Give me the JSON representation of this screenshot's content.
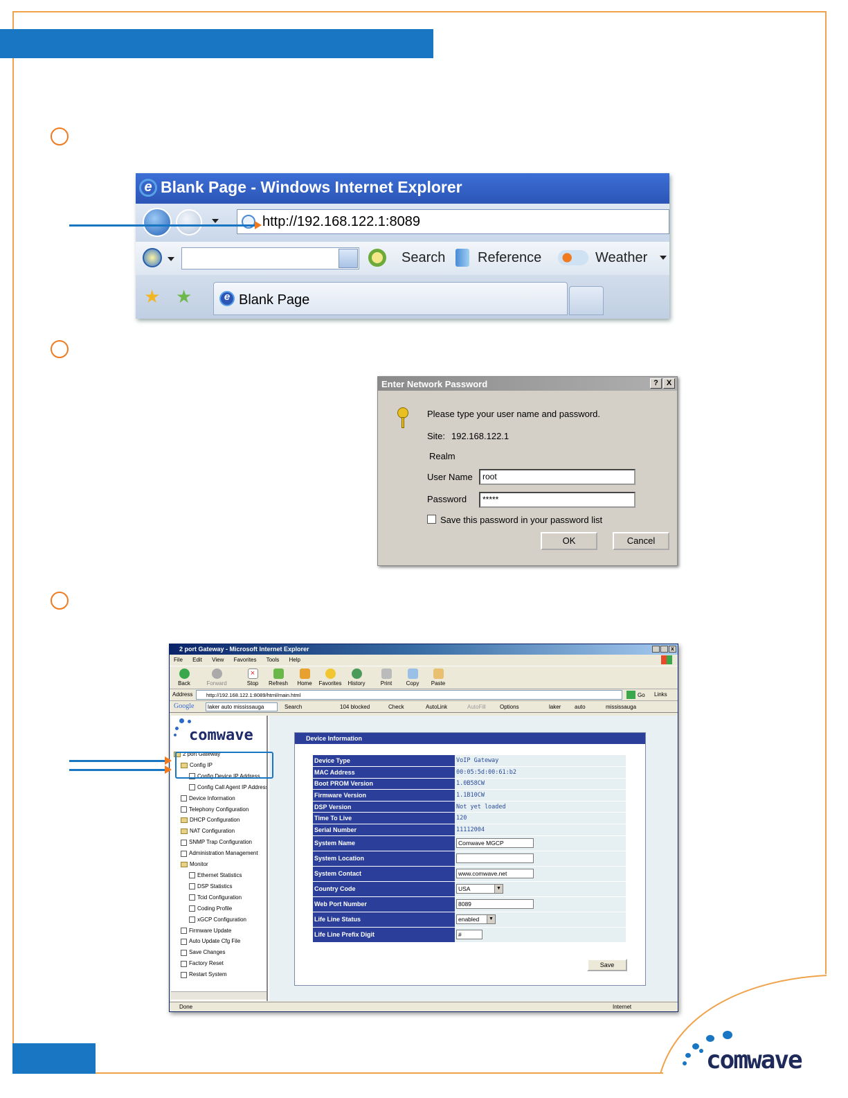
{
  "steps": [
    "",
    "",
    ""
  ],
  "ie7": {
    "title": "Blank Page - Windows Internet Explorer",
    "address": "http://192.168.122.1:8089",
    "toolbar": [
      "Search",
      "Reference",
      "Weather"
    ],
    "tab": "Blank Page",
    "icons": [
      "back-icon",
      "forward-icon",
      "page-icon",
      "favorites-star-icon",
      "search-target-icon",
      "reference-icon",
      "weather-icon",
      "add-favorite-icon",
      "ie-logo-icon"
    ]
  },
  "dialog": {
    "title": "Enter Network Password",
    "help": "?",
    "close": "X",
    "prompt": "Please type your user name and password.",
    "site_label": "Site:",
    "site_value": "192.168.122.1",
    "realm_label": "Realm",
    "username_label": "User Name",
    "username_value": "root",
    "password_label": "Password",
    "password_value": "*****",
    "save_label": "Save this password in your password list",
    "ok": "OK",
    "cancel": "Cancel",
    "icons": [
      "keys-icon"
    ]
  },
  "xp": {
    "title": "2 port Gateway - Microsoft Internet Explorer",
    "menu": [
      "File",
      "Edit",
      "View",
      "Favorites",
      "Tools",
      "Help"
    ],
    "tools": [
      "Back",
      "Forward",
      "Stop",
      "Refresh",
      "Home",
      "Favorites",
      "History",
      "Print",
      "Copy",
      "Paste"
    ],
    "address_label": "Address",
    "address": "http://192.168.122.1:8089/html/main.html",
    "go": "Go",
    "links": "Links",
    "google": {
      "logo": "Google",
      "query": "laker auto mississauga",
      "items": [
        "Search",
        "104 blocked",
        "Check",
        "AutoLink",
        "AutoFill",
        "Options",
        "laker",
        "auto",
        "mississauga"
      ]
    },
    "logo": "comwave",
    "tree": [
      "2 port Gateway",
      "Config IP",
      "Config Device IP Address",
      "Config Call Agent IP Address",
      "Device Information",
      "Telephony Configuration",
      "DHCP Configuration",
      "NAT Configuration",
      "SNMP Trap Configuration",
      "Administration Management",
      "Monitor",
      "Ethernet Statistics",
      "DSP Statistics",
      "Tcid Configuration",
      "Coding Profile",
      "xGCP Configuration",
      "Firmware Update",
      "Auto Update Cfg File",
      "Save Changes",
      "Factory Reset",
      "Restart System"
    ],
    "panel_title": "Device Information",
    "rows": [
      {
        "key": "Device Type",
        "value": "VoIP Gateway"
      },
      {
        "key": "MAC Address",
        "value": "00:05:5d:00:61:b2"
      },
      {
        "key": "Boot PROM Version",
        "value": "1.0B58CW"
      },
      {
        "key": "Firmware Version",
        "value": "1.1B10CW"
      },
      {
        "key": "DSP Version",
        "value": "Not yet loaded"
      },
      {
        "key": "Time To Live",
        "value": "120"
      },
      {
        "key": "Serial Number",
        "value": "11112004"
      },
      {
        "key": "System Name",
        "value": "Comwave MGCP"
      },
      {
        "key": "System Location",
        "value": ""
      },
      {
        "key": "System Contact",
        "value": "www.comwave.net"
      },
      {
        "key": "Country Code",
        "value": "USA"
      },
      {
        "key": "Web Port Number",
        "value": "8089"
      },
      {
        "key": "Life Line Status",
        "value": "enabled"
      },
      {
        "key": "Life Line Prefix Digit",
        "value": "#"
      }
    ],
    "save": "Save",
    "status": "Done",
    "zone": "Internet"
  },
  "footer_logo": "comwave",
  "colors": {
    "brand_blue": "#1976c2",
    "accent_orange": "#f07a20",
    "frame_orange": "#f0a24a"
  }
}
